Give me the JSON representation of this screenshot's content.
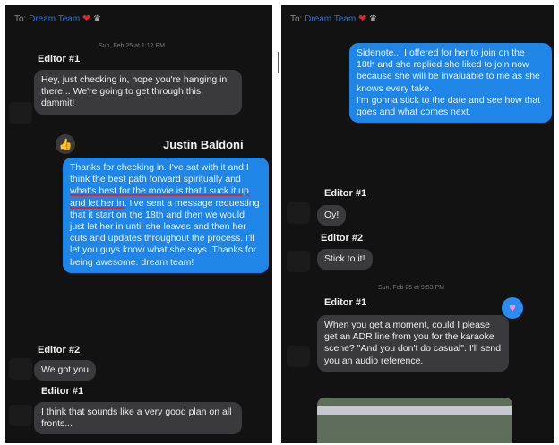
{
  "left_panel": {
    "to_prefix": "To:",
    "recipient": "Dream Team",
    "timestamp": "Sun, Feb 25 at 1:12 PM",
    "messages": [
      {
        "sender": "Editor #1",
        "text": "Hey, just checking in, hope you're hanging in there... We're going to get through this, dammit!"
      },
      {
        "sender": "Justin Baldoni",
        "text_before": "Thanks for checking in. I've sat with it and I think the best path forward spiritually and ",
        "text_underlined": "what's best for the movie is that I suck it up and let her in",
        "text_after": ". I've sent a message requesting that it start on the 18th and then we would just let her in until she leaves and then her cuts and updates throughout the process. I'll let you guys know what she says. Thanks for being awesome. dream team!"
      },
      {
        "sender": "Editor #2",
        "text": "We got you"
      },
      {
        "sender": "Editor #1",
        "text": "I think that sounds like a very good plan on all fronts..."
      }
    ]
  },
  "right_panel": {
    "to_prefix": "To:",
    "recipient": "Dream Team",
    "timestamp": "Sun, Feb 25 at 9:53 PM",
    "messages": [
      {
        "sender": "",
        "text": "Sidenote... I offered for her to join on the 18th and she replied she liked to join now because she will be invaluable to me as she knows every take.\nI'm gonna stick to the date and see how that goes and what comes next."
      },
      {
        "sender": "Editor #1",
        "text": "Oy!"
      },
      {
        "sender": "Editor #2",
        "text": "Stick to it!"
      },
      {
        "sender": "Editor #1",
        "text": "When you get a moment, could I please get an ADR line from you for the karaoke scene? \"And you don't do casual\". I'll send you an audio reference."
      }
    ]
  },
  "icons": {
    "heart": "heart-icon",
    "thumbs_up": "thumbs-up-icon",
    "heart_reaction": "heart-reaction-icon",
    "video": "video-thumbnail"
  },
  "colors": {
    "blue_bubble": "#1f86e8",
    "gray_bubble": "#3a3a3c",
    "underline": "#e0262c"
  }
}
